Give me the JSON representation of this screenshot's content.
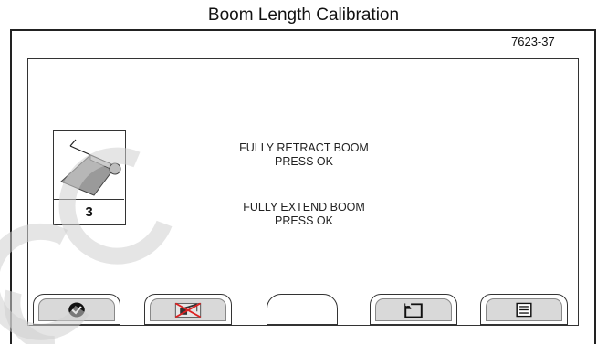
{
  "caption": "Boom Length Calibration",
  "figure_id": "7623-37",
  "step": {
    "number": "3",
    "icon": "boom-length-icon"
  },
  "instructions": [
    {
      "line1": "FULLY RETRACT BOOM",
      "line2": "PRESS OK"
    },
    {
      "line1": "FULLY EXTEND BOOM",
      "line2": "PRESS OK"
    }
  ],
  "softkeys": [
    {
      "icon": "check-circle-icon"
    },
    {
      "icon": "crane-disabled-icon"
    },
    {
      "icon": "blank"
    },
    {
      "icon": "return-icon"
    },
    {
      "icon": "menu-list-icon"
    }
  ]
}
